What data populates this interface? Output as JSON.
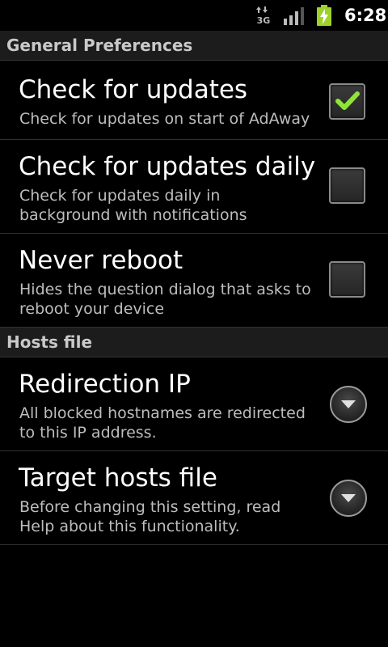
{
  "status_bar": {
    "network_label": "3G",
    "time": "6:28",
    "icons": [
      "data-transfer-icon",
      "signal-icon",
      "battery-charging-icon"
    ]
  },
  "sections": [
    {
      "header": "General Preferences",
      "items": [
        {
          "title": "Check for updates",
          "summary": "Check for updates on start of AdAway",
          "widget": "checkbox",
          "checked": true
        },
        {
          "title": "Check for updates daily",
          "summary": "Check for updates daily in background with notifications",
          "widget": "checkbox",
          "checked": false
        },
        {
          "title": "Never reboot",
          "summary": "Hides the question dialog that asks to reboot your device",
          "widget": "checkbox",
          "checked": false
        }
      ]
    },
    {
      "header": "Hosts file",
      "items": [
        {
          "title": "Redirection IP",
          "summary": "All blocked hostnames are redirected to this IP address.",
          "widget": "dropdown"
        },
        {
          "title": "Target hosts file",
          "summary": "Before changing this setting, read Help about this functionality.",
          "widget": "dropdown"
        }
      ]
    }
  ],
  "colors": {
    "background": "#000000",
    "category_background": "#1c1c1c",
    "category_text": "#c9c9c9",
    "summary_text": "#bdbdbd",
    "check_mark": "#8ee536",
    "battery": "#9fd12b"
  }
}
